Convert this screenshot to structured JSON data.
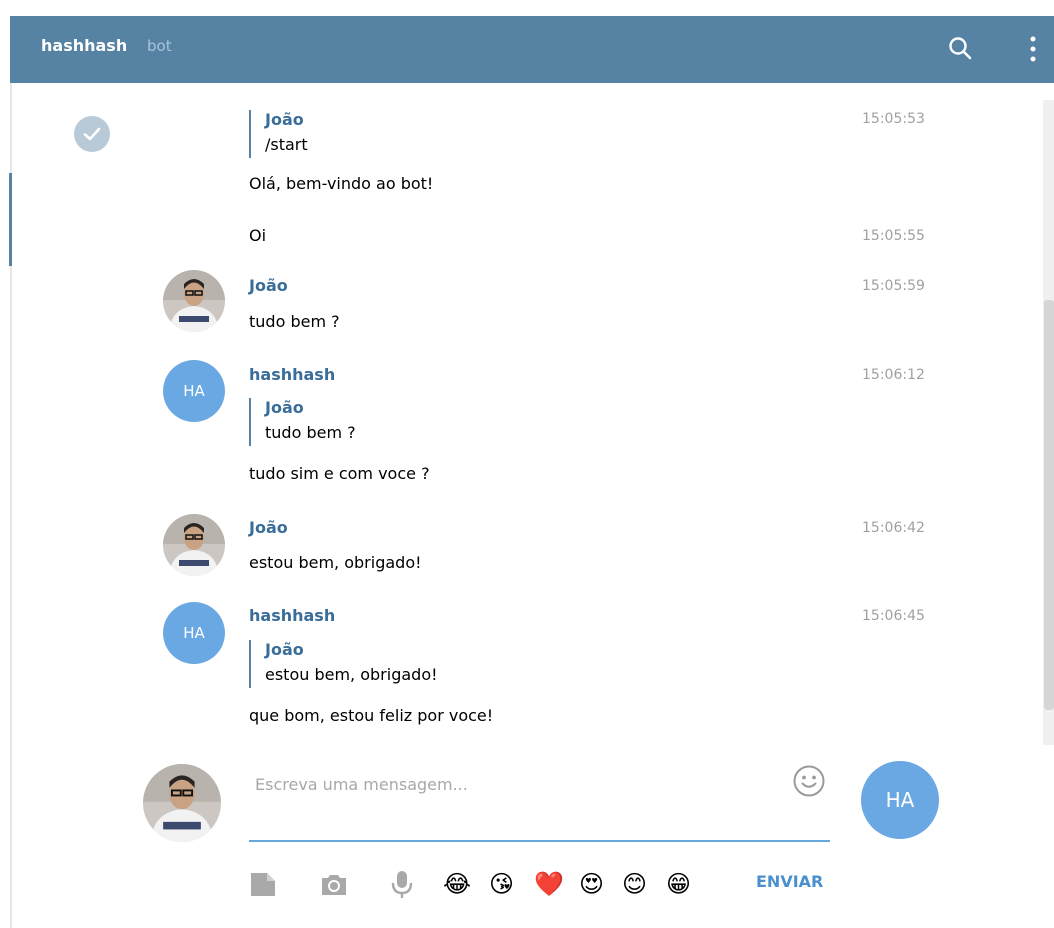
{
  "header": {
    "chat_name": "hashhash",
    "chat_type": "bot"
  },
  "messages": [
    {
      "sender": "João",
      "time": "15:05:53",
      "text": "/start",
      "avatar": "check-icon"
    },
    {
      "text": "Olá, bem-vindo ao bot!"
    },
    {
      "text": "Oi",
      "time": "15:05:55"
    },
    {
      "sender": "João",
      "time": "15:05:59",
      "text": "tudo bem ?",
      "avatar": "user-photo"
    },
    {
      "sender": "hashhash",
      "time": "15:06:12",
      "avatar_initials": "HA",
      "quote": {
        "sender": "João",
        "text": "tudo bem ?"
      },
      "text": "tudo sim e com voce ?"
    },
    {
      "sender": "João",
      "time": "15:06:42",
      "text": "estou bem, obrigado!",
      "avatar": "user-photo"
    },
    {
      "sender": "hashhash",
      "time": "15:06:45",
      "avatar_initials": "HA",
      "quote": {
        "sender": "João",
        "text": "estou bem, obrigado!"
      },
      "text": "que bom, estou feliz por voce!"
    }
  ],
  "composer": {
    "placeholder": "Escreva uma mensagem...",
    "send_label": "ENVIAR",
    "bot_avatar_initials": "HA",
    "quick_emojis": [
      "😂",
      "😘",
      "❤️",
      "😍",
      "😊",
      "😁"
    ]
  },
  "icons": {
    "search": "search-icon",
    "menu": "vertical-dots-icon",
    "file": "file-icon",
    "camera": "camera-icon",
    "mic": "microphone-icon",
    "smiley": "smiley-icon"
  },
  "colors": {
    "header_bg": "#5682a3",
    "sender_name": "#3a6d99",
    "avatar_bg": "#6aa8e3",
    "accent_line": "#66a7dc",
    "send_button": "#4a8fce"
  }
}
